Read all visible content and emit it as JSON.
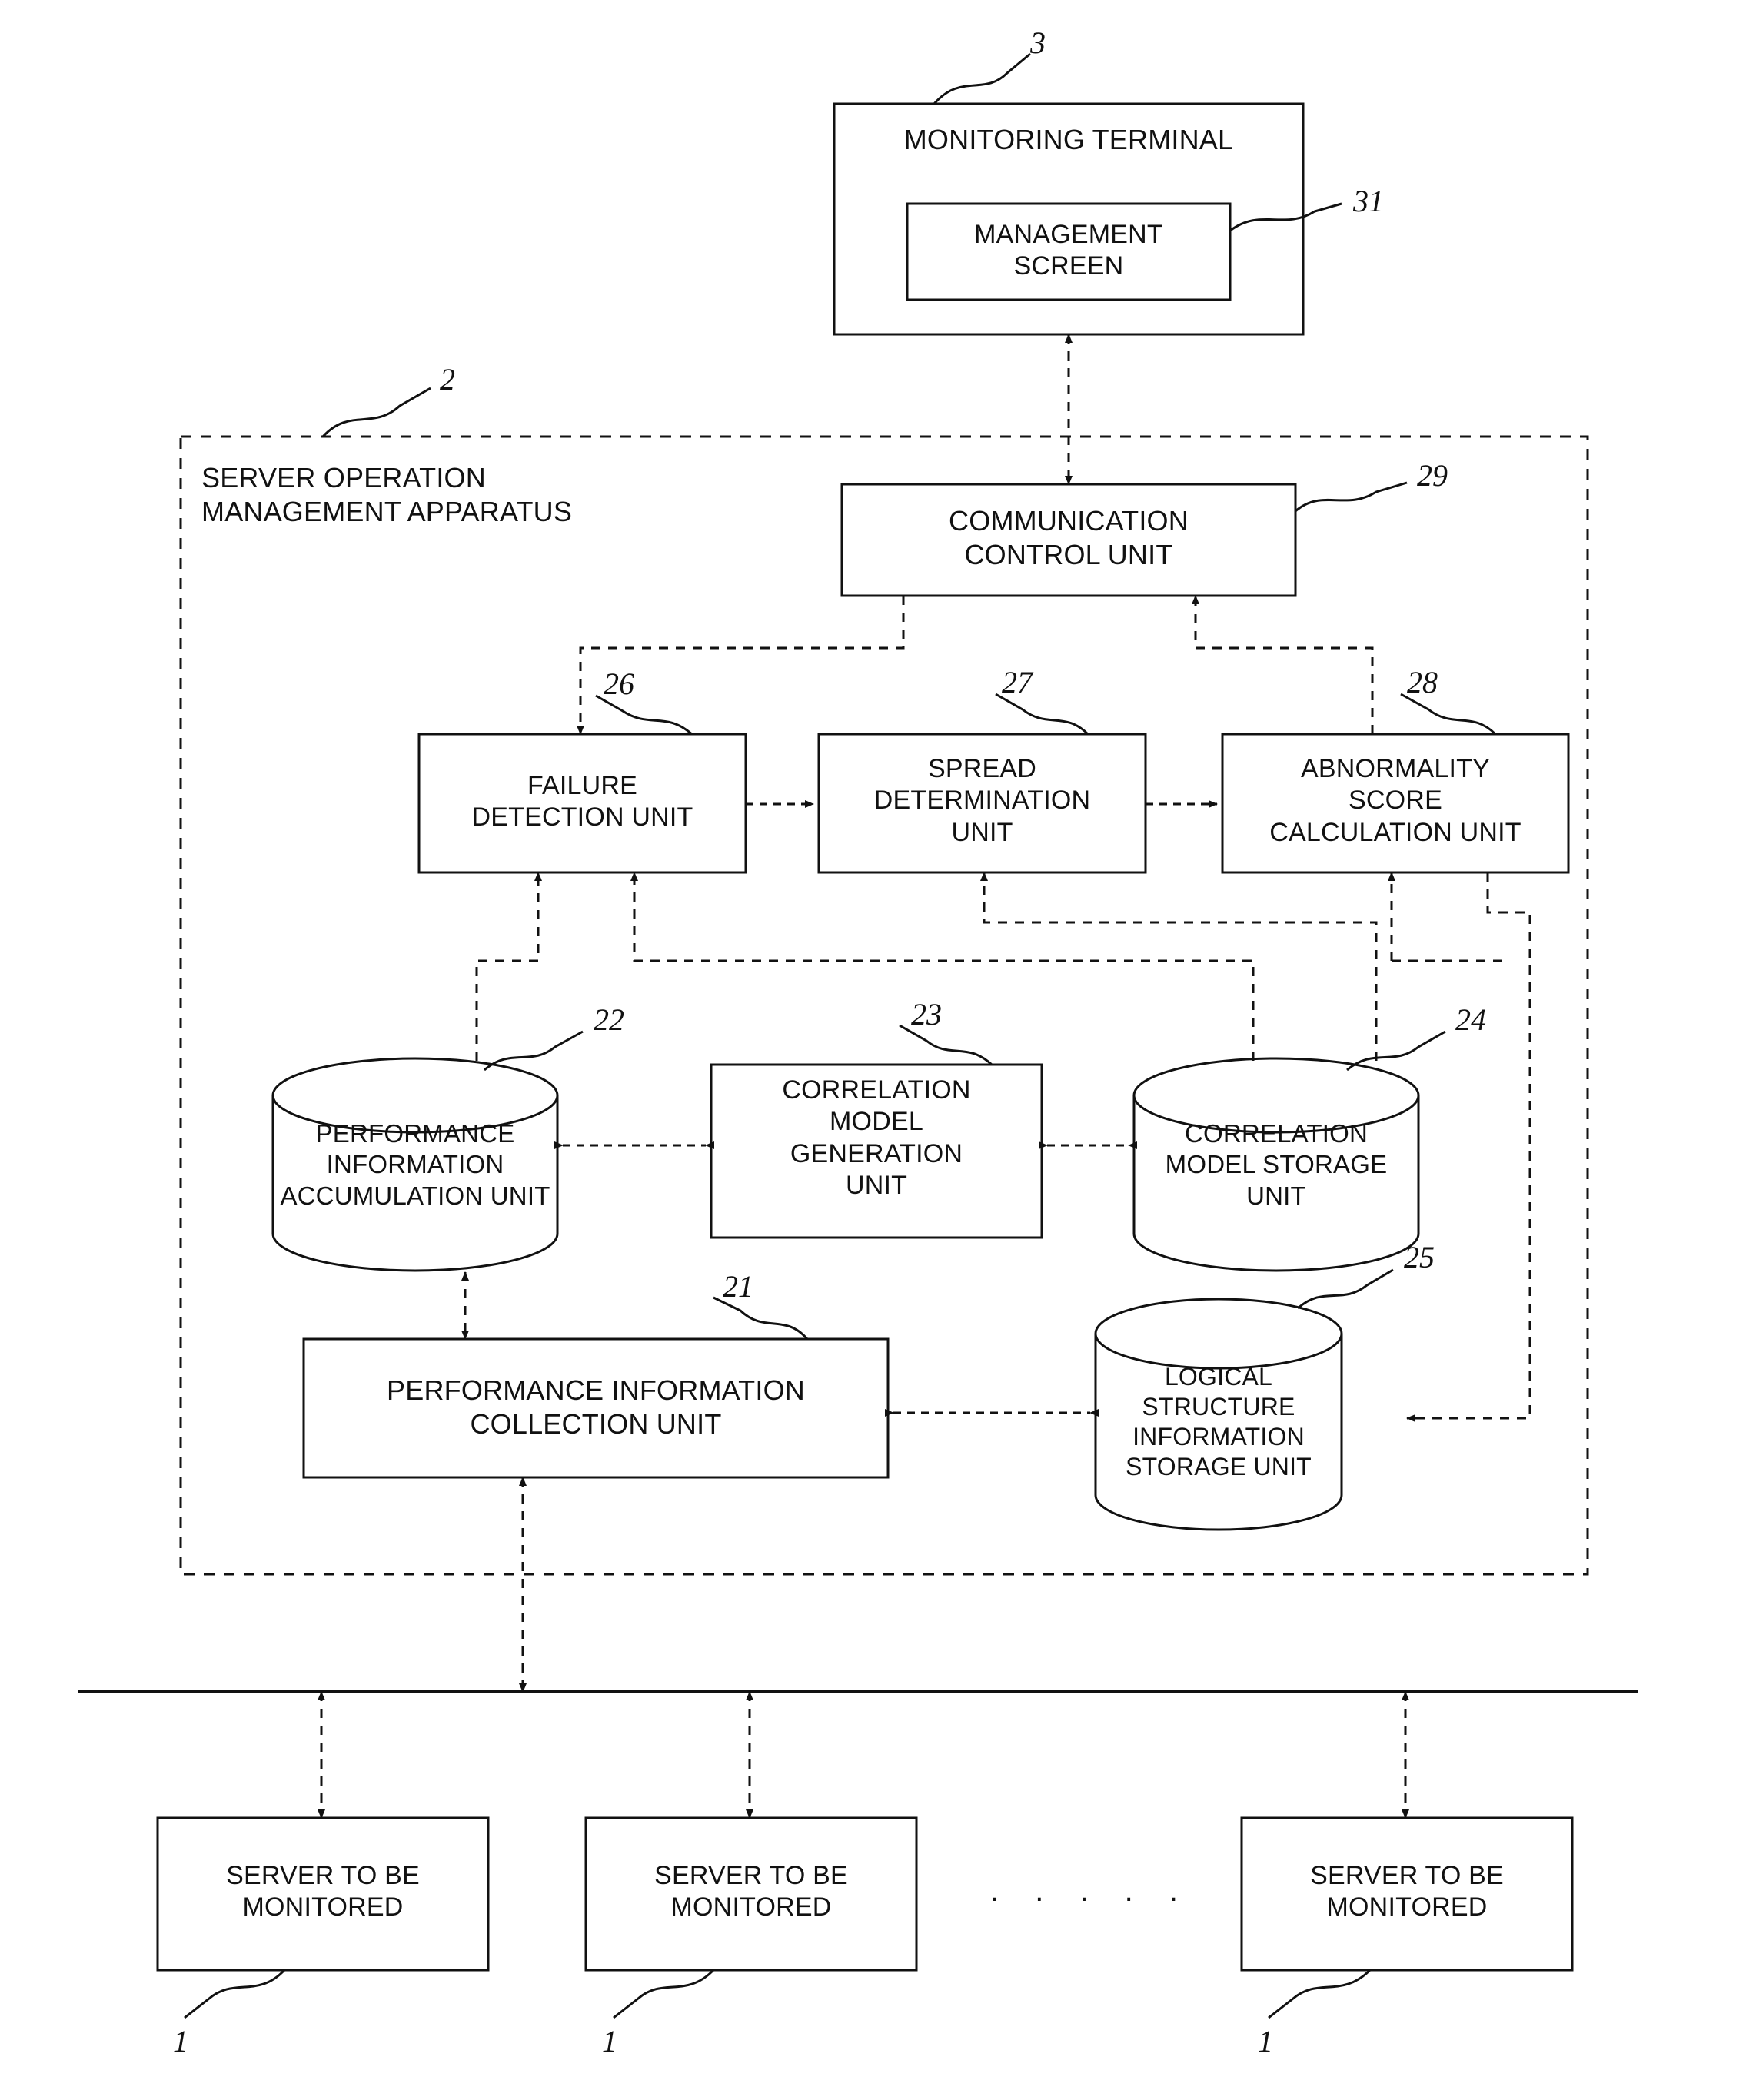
{
  "figure": {
    "type": "patent-block-diagram",
    "title": "Server operation management apparatus block diagram"
  },
  "monitoring_terminal": {
    "label": "MONITORING TERMINAL",
    "ref": "3",
    "management_screen": {
      "label": "MANAGEMENT\nSCREEN",
      "ref": "31"
    }
  },
  "apparatus": {
    "label": "SERVER OPERATION\nMANAGEMENT APPARATUS",
    "ref": "2"
  },
  "units": {
    "communication_control": {
      "label": "COMMUNICATION\nCONTROL UNIT",
      "ref": "29"
    },
    "failure_detection": {
      "label": "FAILURE\nDETECTION UNIT",
      "ref": "26"
    },
    "spread_determination": {
      "label": "SPREAD\nDETERMINATION\nUNIT",
      "ref": "27"
    },
    "abnormality_score": {
      "label": "ABNORMALITY\nSCORE\nCALCULATION UNIT",
      "ref": "28"
    },
    "performance_accumulation": {
      "label": "PERFORMANCE\nINFORMATION\nACCUMULATION UNIT",
      "ref": "22"
    },
    "correlation_model_generation": {
      "label": "CORRELATION\nMODEL\nGENERATION\nUNIT",
      "ref": "23"
    },
    "correlation_model_storage": {
      "label": "CORRELATION\nMODEL STORAGE\nUNIT",
      "ref": "24"
    },
    "logical_structure_storage": {
      "label": "LOGICAL\nSTRUCTURE\nINFORMATION\nSTORAGE UNIT",
      "ref": "25"
    },
    "performance_collection": {
      "label": "PERFORMANCE INFORMATION\nCOLLECTION UNIT",
      "ref": "21"
    }
  },
  "servers": [
    {
      "label": "SERVER TO BE\nMONITORED",
      "ref": "1"
    },
    {
      "label": "SERVER TO BE\nMONITORED",
      "ref": "1"
    },
    {
      "label": "SERVER TO BE\nMONITORED",
      "ref": "1"
    }
  ],
  "ellipsis": ". . . . .",
  "colors": {
    "line": "#111111",
    "background": "#ffffff"
  }
}
